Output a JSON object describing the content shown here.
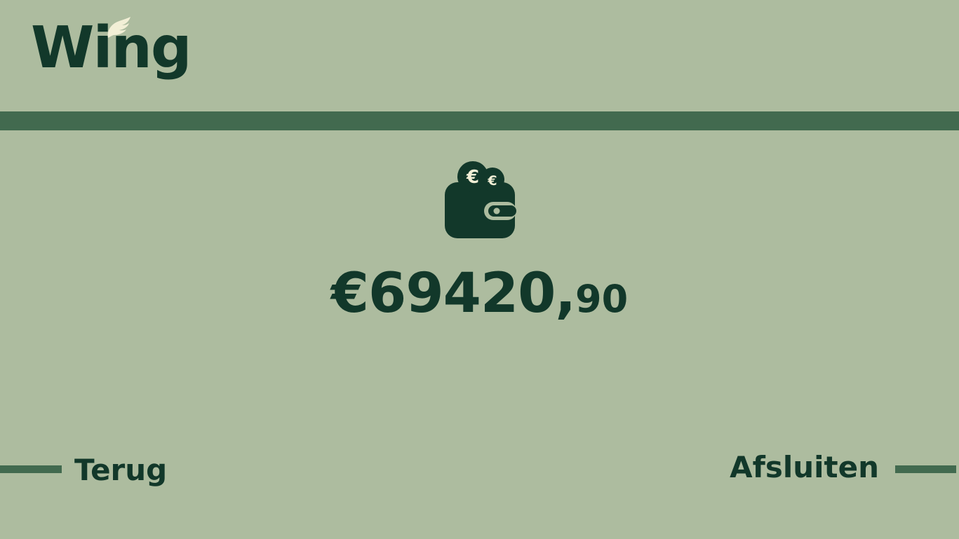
{
  "brand": {
    "name": "Wing",
    "logo_icon": "wing-icon"
  },
  "wallet": {
    "icon": "wallet-with-euro-coins-icon",
    "balance_main": "€69420,",
    "balance_cents": "90"
  },
  "nav": {
    "back_label": "Terug",
    "close_label": "Afsluiten"
  },
  "colors": {
    "background": "#adbc9f",
    "accent_bar": "#426a4f",
    "text": "#12382a",
    "wing_accent": "#f2efd6"
  }
}
